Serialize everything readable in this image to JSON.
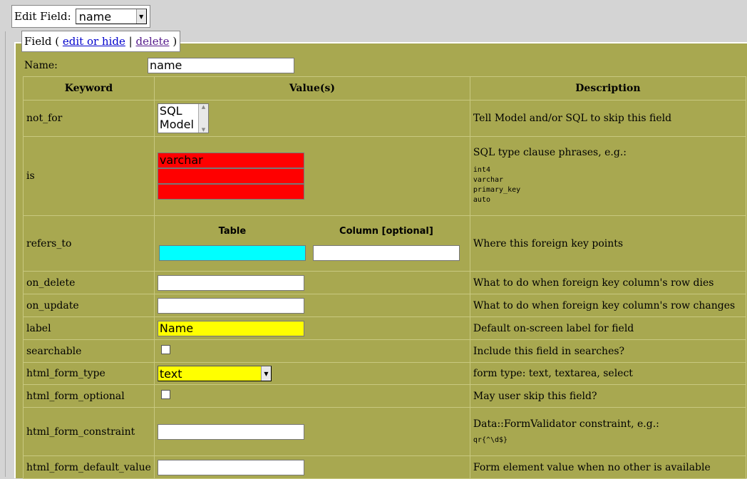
{
  "header": {
    "edit_field_label": "Edit Field:",
    "edit_field_value": "name"
  },
  "field_legend": {
    "prefix": "Field (",
    "edit_link": "edit or hide",
    "separator": "|",
    "delete_link": "delete",
    "suffix": ")"
  },
  "name_row": {
    "label": "Name:",
    "value": "name"
  },
  "table": {
    "headers": [
      "Keyword",
      "Value(s)",
      "Description"
    ],
    "rows": {
      "not_for": {
        "keyword": "not_for",
        "options": [
          "SQL",
          "Model"
        ],
        "description": "Tell Model and/or SQL to skip this field"
      },
      "is": {
        "keyword": "is",
        "values": [
          "varchar",
          "",
          ""
        ],
        "description": "SQL type clause phrases, e.g.:",
        "examples": [
          "int4",
          "varchar",
          "primary_key",
          "auto"
        ]
      },
      "refers_to": {
        "keyword": "refers_to",
        "table_header": "Table",
        "column_header": "Column [optional]",
        "table_value": "",
        "column_value": "",
        "description": "Where this foreign key points"
      },
      "on_delete": {
        "keyword": "on_delete",
        "value": "",
        "description": "What to do when foreign key column's row dies"
      },
      "on_update": {
        "keyword": "on_update",
        "value": "",
        "description": "What to do when foreign key column's row changes"
      },
      "label": {
        "keyword": "label",
        "value": "Name",
        "description": "Default on-screen label for field"
      },
      "searchable": {
        "keyword": "searchable",
        "checked": false,
        "description": "Include this field in searches?"
      },
      "html_form_type": {
        "keyword": "html_form_type",
        "value": "text",
        "description": "form type: text, textarea, select"
      },
      "html_form_optional": {
        "keyword": "html_form_optional",
        "checked": false,
        "description": "May user skip this field?"
      },
      "html_form_constraint": {
        "keyword": "html_form_constraint",
        "value": "",
        "description": "Data::FormValidator constraint, e.g.:",
        "example": "qr{^\\d$}"
      },
      "html_form_default_value": {
        "keyword": "html_form_default_value",
        "value": "",
        "description": "Form element value when no other is available"
      }
    }
  },
  "colors": {
    "panel": "#a8a850",
    "highlight_red": "#ff0000",
    "highlight_yellow": "#ffff00",
    "highlight_cyan": "#00ffff"
  }
}
